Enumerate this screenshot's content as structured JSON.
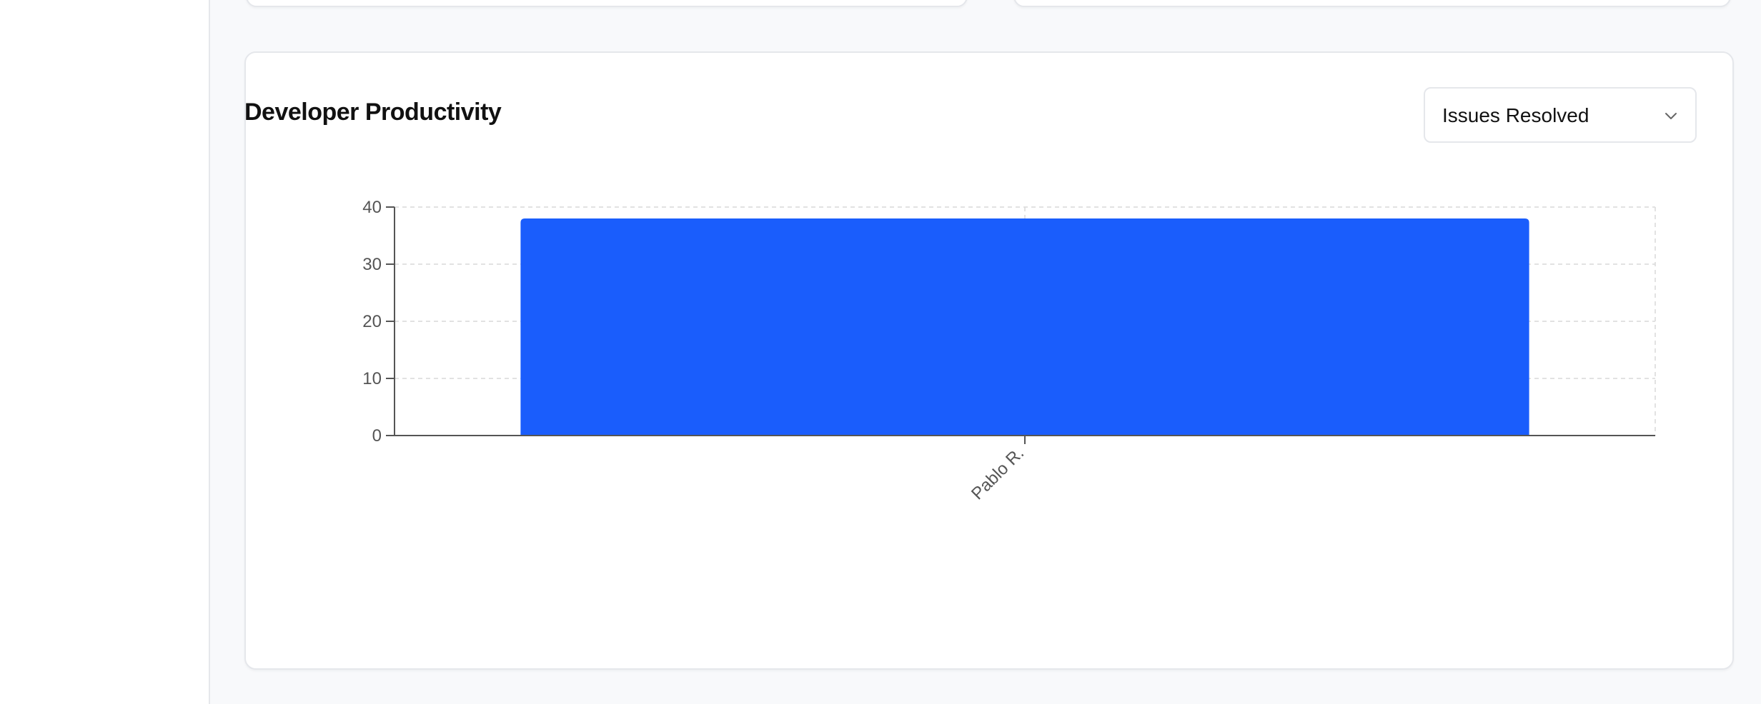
{
  "card": {
    "title": "Developer Productivity"
  },
  "metric_select": {
    "selected": "Issues Resolved",
    "icon": "chevron-down-icon"
  },
  "colors": {
    "bar": "#1a5dfc",
    "grid": "#d9d9d9",
    "axis": "#555555"
  },
  "chart_data": {
    "type": "bar",
    "categories": [
      "Pablo R."
    ],
    "series": [
      {
        "values": [
          38
        ]
      }
    ],
    "ylim": [
      0,
      40
    ],
    "yticks": [
      0,
      10,
      20,
      30,
      40
    ],
    "grid": true,
    "legend": "none"
  }
}
